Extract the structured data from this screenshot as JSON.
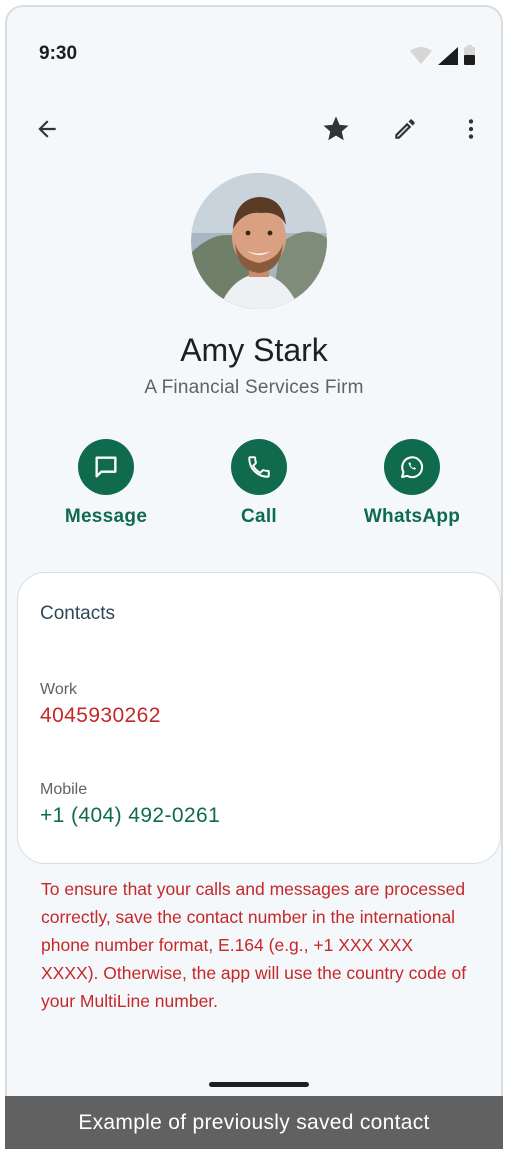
{
  "status": {
    "time": "9:30"
  },
  "contact": {
    "name": "Amy Stark",
    "company": "A Financial Services Firm"
  },
  "actions": [
    {
      "label": "Message",
      "icon": "message-icon"
    },
    {
      "label": "Call",
      "icon": "phone-icon"
    },
    {
      "label": "WhatsApp",
      "icon": "whatsapp-icon"
    }
  ],
  "card": {
    "title": "Contacts",
    "fields": [
      {
        "label": "Work",
        "value": "4045930262",
        "color": "#c62828"
      },
      {
        "label": "Mobile",
        "value": "+1 (404) 492-0261",
        "color": "#0f6b4c"
      }
    ]
  },
  "note": "To ensure that your calls and messages are processed correctly, save the contact number in the international phone number format, E.164 (e.g., +1 XXX XXX XXXX). Otherwise, the app will use the country code of your MultiLine number.",
  "caption": "Example of previously saved contact",
  "colors": {
    "accent": "#0f6b4c",
    "warning": "#c62828"
  }
}
